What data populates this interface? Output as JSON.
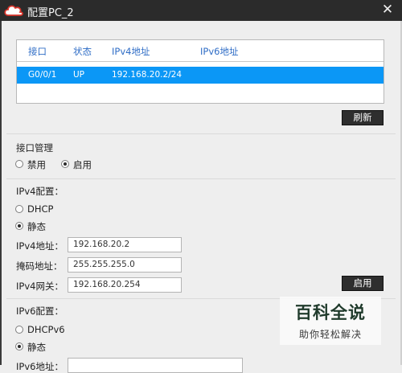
{
  "window": {
    "title": "配置PC_2",
    "close_icon": "close-icon"
  },
  "interfaces": {
    "headers": [
      "接口",
      "状态",
      "IPv4地址",
      "IPv6地址"
    ],
    "rows": [
      {
        "interface": "G0/0/1",
        "status": "UP",
        "ipv4": "192.168.20.2/24",
        "ipv6": ""
      }
    ],
    "refresh_label": "刷新"
  },
  "interface_mgmt": {
    "title": "接口管理",
    "options": [
      {
        "label": "禁用",
        "selected": false
      },
      {
        "label": "启用",
        "selected": true
      }
    ]
  },
  "ipv4": {
    "title": "IPv4配置：",
    "options": [
      {
        "label": "DHCP",
        "selected": false
      },
      {
        "label": "静态",
        "selected": true
      }
    ],
    "address_label": "IPv4地址：",
    "address": "192.168.20.2",
    "mask_label": "掩码地址：",
    "mask": "255.255.255.0",
    "gateway_label": "IPv4网关：",
    "gateway": "192.168.20.254",
    "apply_label": "启用"
  },
  "ipv6": {
    "title": "IPv6配置：",
    "options": [
      {
        "label": "DHCPv6",
        "selected": false
      },
      {
        "label": "静态",
        "selected": true
      }
    ],
    "address_label": "IPv6地址：",
    "address": ""
  },
  "watermark": {
    "title": "百科全说",
    "subtitle": "助你轻松解决"
  },
  "colors": {
    "titlebar": "#2b2b2b",
    "selection": "#0b97f6",
    "header_text": "#2f6dc6",
    "button": "#2e2e2e"
  }
}
